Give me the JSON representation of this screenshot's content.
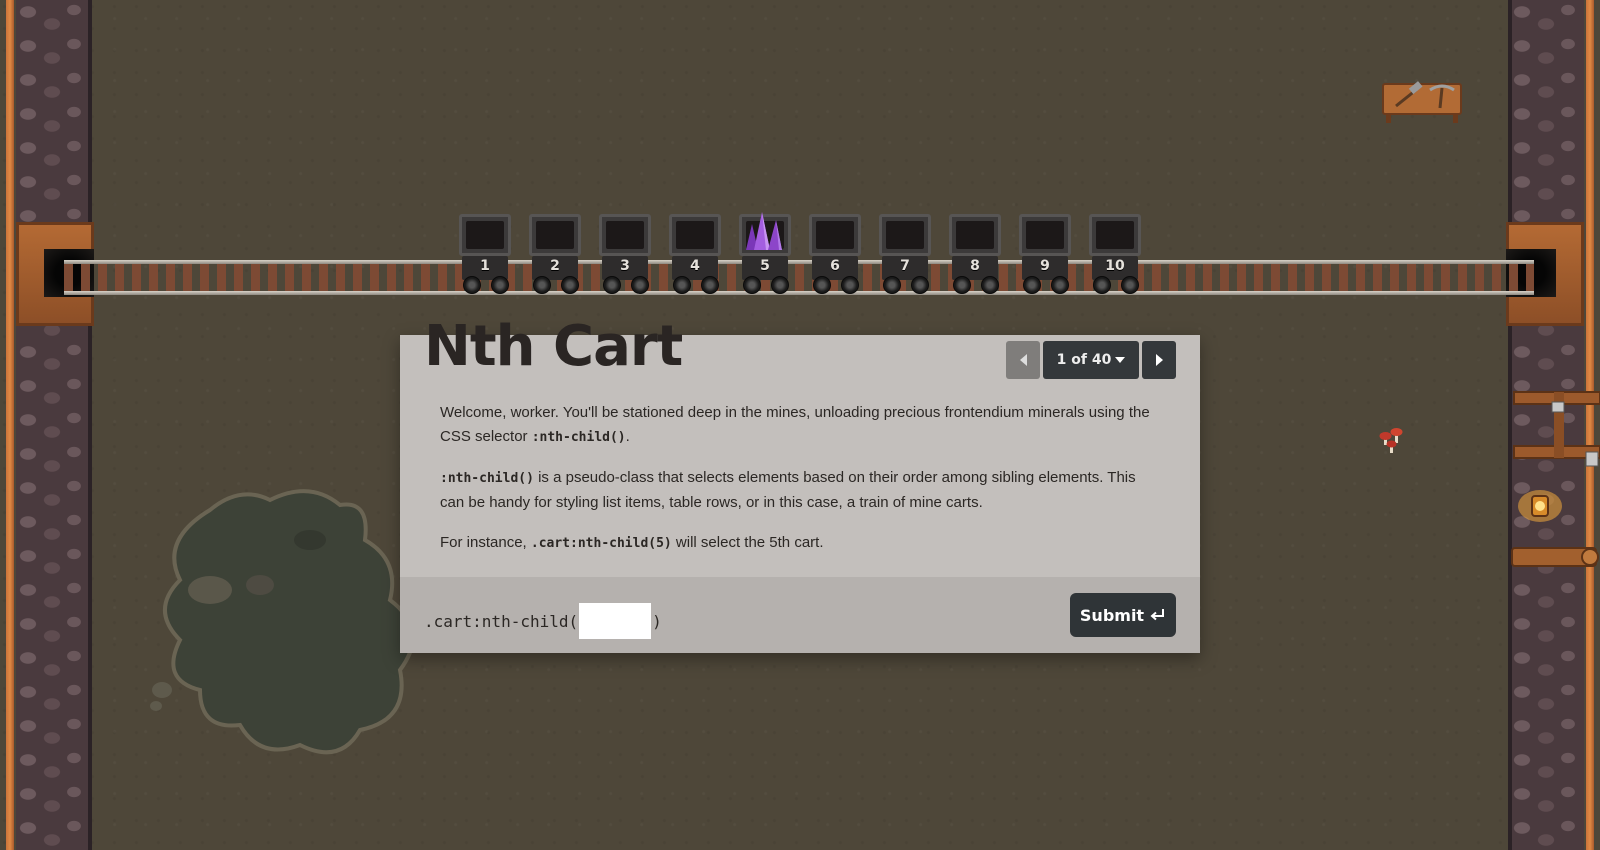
{
  "level": {
    "title": "Nth Cart",
    "progress": "1 of 40"
  },
  "carts": [
    {
      "label": "1",
      "cargo": "empty"
    },
    {
      "label": "2",
      "cargo": "empty"
    },
    {
      "label": "3",
      "cargo": "empty"
    },
    {
      "label": "4",
      "cargo": "empty"
    },
    {
      "label": "5",
      "cargo": "purple-crystal"
    },
    {
      "label": "6",
      "cargo": "empty"
    },
    {
      "label": "7",
      "cargo": "empty"
    },
    {
      "label": "8",
      "cargo": "empty"
    },
    {
      "label": "9",
      "cargo": "empty"
    },
    {
      "label": "10",
      "cargo": "empty"
    }
  ],
  "instructions": {
    "p1_before": "Welcome, worker. You'll be stationed deep in the mines, unloading precious frontendium minerals using the CSS selector ",
    "p1_code": ":nth-child()",
    "p1_after": ".",
    "p2_code": ":nth-child()",
    "p2_after": " is a pseudo-class that selects elements based on their order among sibling elements. This can be handy for styling list items, table rows, or in this case, a train of mine carts.",
    "p3_before": "For instance, ",
    "p3_code": ".cart:nth-child(5)",
    "p3_after": " will select the 5th cart."
  },
  "answer": {
    "prefix": ".cart:nth-child(",
    "value": "",
    "suffix": ")",
    "submit_label": "Submit",
    "submit_icon": "enter-key-icon"
  },
  "colors": {
    "ground": "#4e4739",
    "panel": "#c3bfbc",
    "answer_bar": "#b5b1ae",
    "button_dark": "#34383b",
    "button_disabled": "#7f7d7b",
    "crystal": "#9b4fd6",
    "wall_trim": "#e08a44"
  }
}
